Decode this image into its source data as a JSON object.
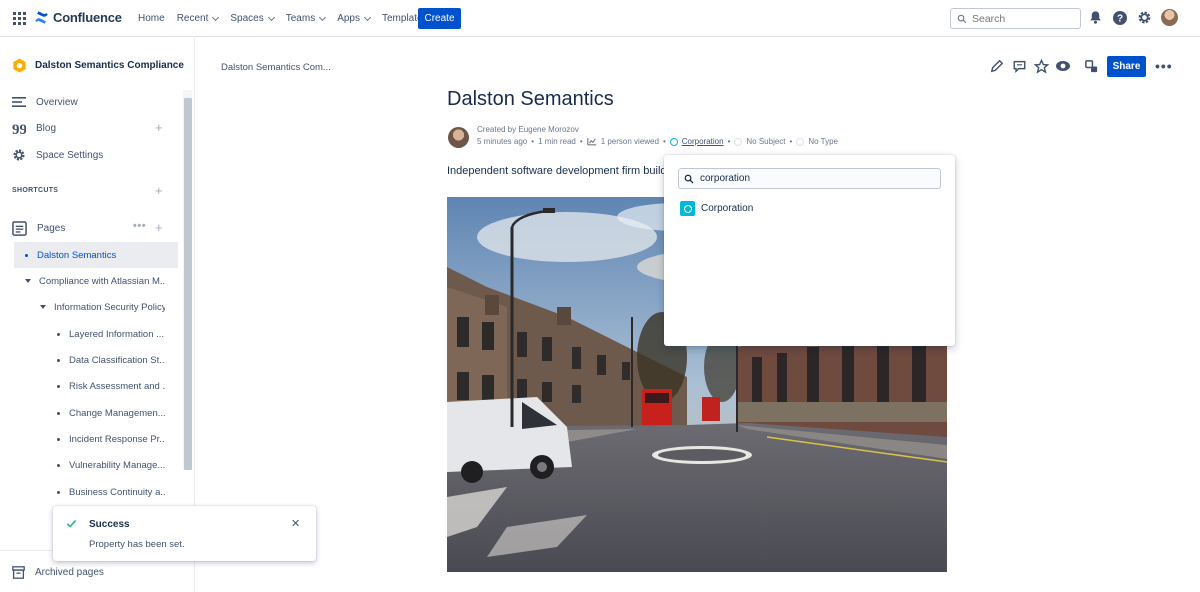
{
  "topnav": {
    "product": "Confluence",
    "items": [
      {
        "label": "Home",
        "has_menu": false
      },
      {
        "label": "Recent",
        "has_menu": true
      },
      {
        "label": "Spaces",
        "has_menu": true
      },
      {
        "label": "Teams",
        "has_menu": true
      },
      {
        "label": "Apps",
        "has_menu": true
      },
      {
        "label": "Templates",
        "has_menu": false
      }
    ],
    "create_label": "Create",
    "search_placeholder": "Search",
    "icons": [
      "notifications-icon",
      "help-icon",
      "settings-icon",
      "profile-avatar"
    ]
  },
  "sidebar": {
    "space_name": "Dalston Semantics Compliance",
    "nav": [
      {
        "label": "Overview",
        "icon": "overview-icon"
      },
      {
        "label": "Blog",
        "icon": "quote-icon"
      },
      {
        "label": "Space Settings",
        "icon": "gear-icon"
      }
    ],
    "shortcuts_label": "SHORTCUTS",
    "pages_label": "Pages",
    "tree": [
      {
        "label": "Dalston Semantics",
        "level": 0,
        "type": "bullet",
        "selected": true
      },
      {
        "label": "Compliance with Atlassian M...",
        "level": 0,
        "type": "expanded"
      },
      {
        "label": "Information Security Policy",
        "level": 1,
        "type": "expanded"
      },
      {
        "label": "Layered Information ...",
        "level": 2,
        "type": "bullet"
      },
      {
        "label": "Data Classification St...",
        "level": 2,
        "type": "bullet"
      },
      {
        "label": "Risk Assessment and ...",
        "level": 2,
        "type": "bullet"
      },
      {
        "label": "Change Managemen...",
        "level": 2,
        "type": "bullet"
      },
      {
        "label": "Incident Response Pr...",
        "level": 2,
        "type": "bullet"
      },
      {
        "label": "Vulnerability Manage...",
        "level": 2,
        "type": "bullet"
      },
      {
        "label": "Business Continuity a...",
        "level": 2,
        "type": "bullet"
      }
    ],
    "archived_label": "Archived pages"
  },
  "toast": {
    "title": "Success",
    "message": "Property has been set."
  },
  "page": {
    "breadcrumb": "Dalston Semantics Com...",
    "share_label": "Share",
    "title": "Dalston Semantics",
    "created_by_prefix": "Created by",
    "author": "Eugene Morozov",
    "created_ago": "5 minutes ago",
    "read_time": "1 min read",
    "viewed": "1 person viewed",
    "property_corporation": "Corporation",
    "property_subject": "No Subject",
    "property_type": "No Type",
    "description": "Independent software development firm building"
  },
  "property_dropdown": {
    "search_value": "corporation",
    "options": [
      {
        "label": "Corporation"
      }
    ]
  },
  "colors": {
    "primary": "#0052cc",
    "selected_bg": "#ebecf0",
    "property_accent": "#00b8d9",
    "success": "#36b37e"
  }
}
